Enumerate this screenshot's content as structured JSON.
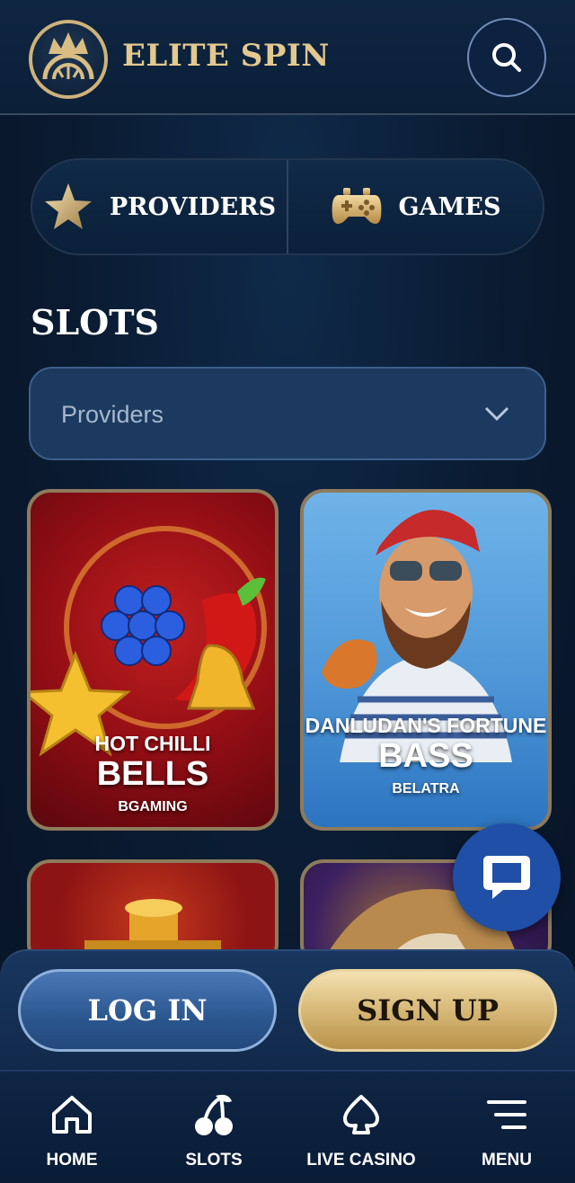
{
  "header": {
    "brand": "ELITE SPIN",
    "logo_icon": "crown-roulette-icon",
    "search_icon": "search-icon"
  },
  "switcher": {
    "items": [
      {
        "label": "PROVIDERS",
        "icon": "star-icon"
      },
      {
        "label": "GAMES",
        "icon": "gamepad-icon"
      }
    ]
  },
  "section": {
    "title": "SLOTS"
  },
  "providers_filter": {
    "placeholder": "Providers",
    "icon": "chevron-down-icon"
  },
  "games": [
    {
      "title_small": "HOT CHILLI",
      "title_big": "BELLS",
      "provider": "BGAMING"
    },
    {
      "title_small": "DANLUDAN'S FORTUNE",
      "title_big": "BASS",
      "provider": "BELATRA"
    },
    {
      "title_small": "",
      "title_big": "",
      "provider": ""
    },
    {
      "title_small": "",
      "title_big": "",
      "provider": ""
    }
  ],
  "chat": {
    "icon": "chat-bubble-icon"
  },
  "auth": {
    "login_label": "LOG IN",
    "signup_label": "SIGN UP"
  },
  "bottom_nav": [
    {
      "label": "HOME",
      "icon": "home-icon"
    },
    {
      "label": "SLOTS",
      "icon": "cherries-icon"
    },
    {
      "label": "LIVE CASINO",
      "icon": "spade-icon"
    },
    {
      "label": "MENU",
      "icon": "menu-icon"
    }
  ],
  "colors": {
    "background": "#0a1a30",
    "gold": "#e3c98f",
    "login_blue": "#2b578f",
    "signup_gold": "#d7b877",
    "chat_blue": "#1f4fa6"
  }
}
